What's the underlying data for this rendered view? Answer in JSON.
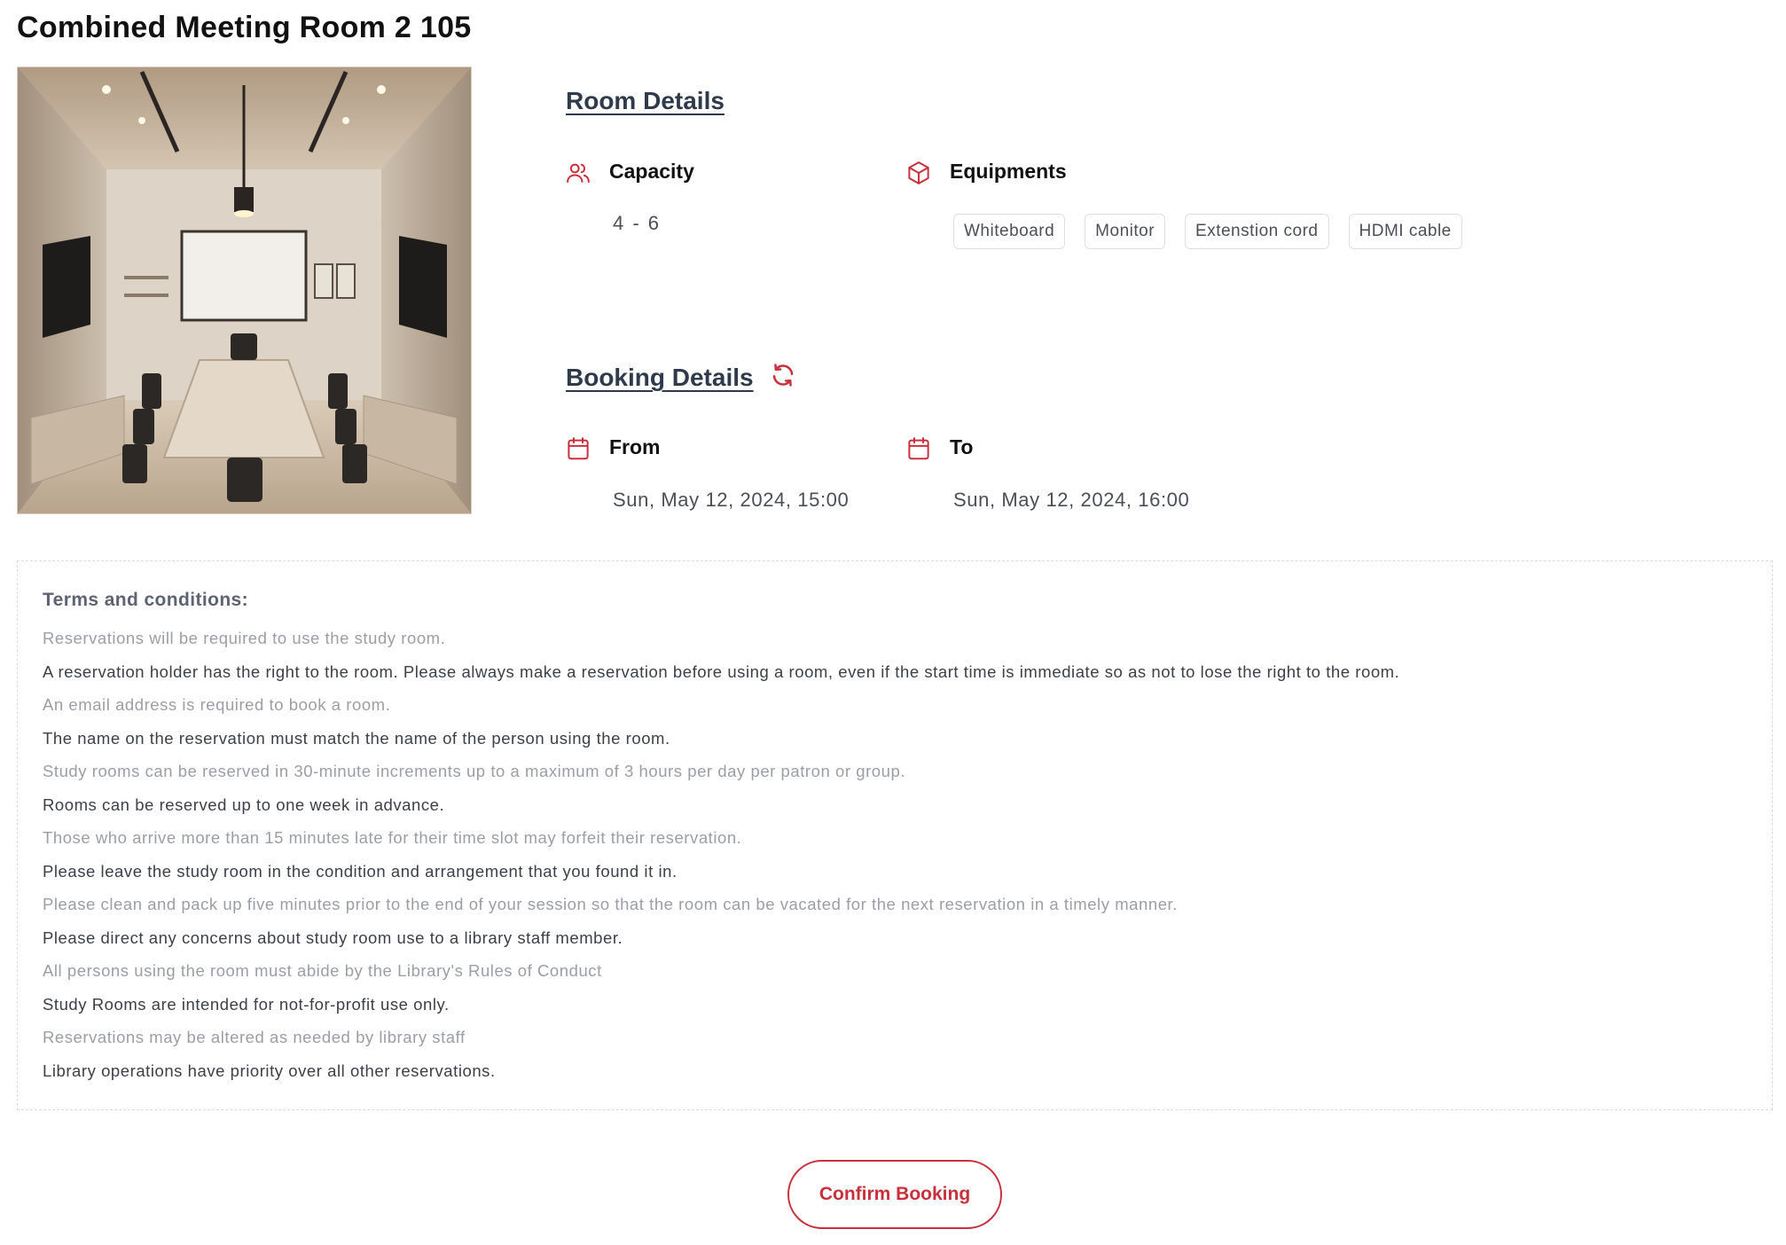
{
  "room": {
    "title": "Combined Meeting Room 2 105",
    "image_alt": "Meeting room photo"
  },
  "room_details": {
    "heading": "Room Details",
    "capacity": {
      "label": "Capacity",
      "value": "4 - 6",
      "icon": "users-icon"
    },
    "equipments": {
      "label": "Equipments",
      "icon": "box-icon",
      "items": [
        "Whiteboard",
        "Monitor",
        "Extenstion cord",
        "HDMI cable"
      ]
    }
  },
  "booking_details": {
    "heading": "Booking Details",
    "refresh_icon": "refresh-icon",
    "from": {
      "label": "From",
      "value": "Sun, May 12, 2024, 15:00",
      "icon": "calendar-icon"
    },
    "to": {
      "label": "To",
      "value": "Sun, May 12, 2024, 16:00",
      "icon": "calendar-icon"
    }
  },
  "terms": {
    "title": "Terms and conditions:",
    "items": [
      "Reservations will be required to use the study room.",
      "A reservation holder has the right to the room. Please always make a reservation before using a room, even if the start time is immediate so as not to lose the right to the room.",
      "An email address is required to book a room.",
      "The name on the reservation must match the name of the person using the room.",
      "Study rooms can be reserved in 30-minute increments up to a maximum of 3 hours per day per patron or group.",
      "Rooms can be reserved up to one week in advance.",
      "Those who arrive more than 15 minutes late for their time slot may forfeit their reservation.",
      "Please leave the study room in the condition and arrangement that you found it in.",
      "Please clean and pack up five minutes prior to the end of your session so that the room can be vacated for the next reservation in a timely manner.",
      "Please direct any concerns about study room use to a library staff member.",
      "All persons using the room must abide by the Library's Rules of Conduct",
      "Study Rooms are intended for not-for-profit use only.",
      "Reservations may be altered as needed by library staff",
      "Library operations have priority over all other reservations."
    ]
  },
  "actions": {
    "confirm_label": "Confirm Booking"
  },
  "colors": {
    "accent": "#c8313c",
    "heading": "#2f3a4a",
    "muted_text": "#9a9ea6",
    "body_text": "#3b4049"
  }
}
